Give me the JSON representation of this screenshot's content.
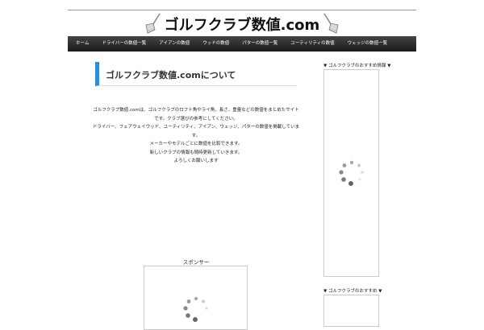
{
  "site": {
    "logo_text": "ゴルフクラブ数値.com"
  },
  "nav": {
    "items": [
      {
        "label": "ホーム"
      },
      {
        "label": "ドライバーの数値一覧"
      },
      {
        "label": "アイアンの数値"
      },
      {
        "label": "ウッドの数値"
      },
      {
        "label": "パターの数値一覧"
      },
      {
        "label": "ユーティリティの数値"
      },
      {
        "label": "ウェッジの数値一覧"
      }
    ]
  },
  "main": {
    "title": "ゴルフクラブ数値.comについて",
    "intro_lines": [
      "ゴルフクラブ数値.comは、ゴルフクラブのロフト角やライ角、長さ、重量などの数値をまとめたサイトです。クラブ選びの参考にしてください。",
      "ドライバー、フェアウェイウッド、ユーティリティ、アイアン、ウェッジ、パターの数値を掲載しています。",
      "メーカーやモデルごとに数値を比較できます。",
      "新しいクラブの情報も随時更新していきます。",
      "よろしくお願いします"
    ],
    "ad_label": "スポンサー"
  },
  "sidebar": {
    "box1_label": "▼ ゴルフクラブのおすすめ情報 ▼",
    "box2_label": "▼ ゴルフクラブのおすすめ ▼"
  },
  "colors": {
    "accent": "#2a8fd6",
    "nav_bg": "#222222"
  }
}
